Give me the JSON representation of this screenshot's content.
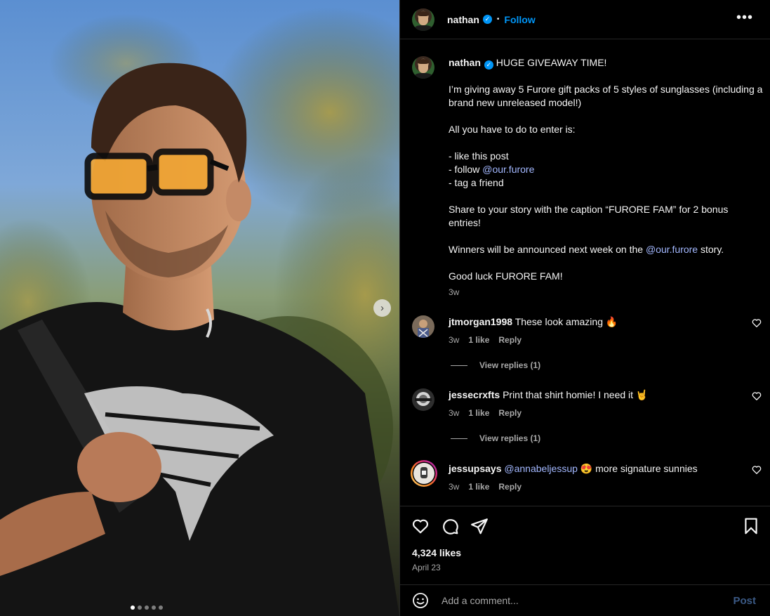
{
  "header": {
    "username": "nathan",
    "separator": "•",
    "follow_label": "Follow",
    "more_icon": "more-horizontal-icon"
  },
  "caption": {
    "username": "nathan",
    "title": "HUGE GIVEAWAY TIME!",
    "line1": "I’m giving away 5 Furore gift packs of 5 styles of sunglasses (including a brand new unreleased model!)",
    "line2": "All you have to do to enter is:",
    "step1": "- like this post",
    "step2_prefix": "- follow ",
    "step2_mention": "@our.furore",
    "step3": "- tag a friend",
    "line3": "Share to your story with the caption “FURORE FAM” for 2 bonus entries!",
    "line4_prefix": "Winners will be announced next week on the ",
    "line4_mention": "@our.furore",
    "line4_suffix": " story.",
    "line5": "Good luck FURORE FAM!",
    "time": "3w"
  },
  "comments": [
    {
      "username": "jtmorgan1998",
      "text": "These look amazing 🔥",
      "time": "3w",
      "likes": "1 like",
      "reply_label": "Reply",
      "view_replies": "View replies (1)"
    },
    {
      "username": "jessecrxfts",
      "text": "Print that shirt homie! I need it 🤘",
      "time": "3w",
      "likes": "1 like",
      "reply_label": "Reply",
      "view_replies": "View replies (1)"
    },
    {
      "username": "jessupsays",
      "mention": "@annabeljessup",
      "text": " 😍 more signature sunnies",
      "time": "3w",
      "likes": "1 like",
      "reply_label": "Reply"
    }
  ],
  "actions": {
    "likes": "4,324 likes",
    "date": "April 23"
  },
  "add_comment": {
    "placeholder": "Add a comment...",
    "post_label": "Post"
  },
  "media": {
    "next_arrow": "›",
    "slide_count": 5,
    "active_slide": 1
  },
  "colors": {
    "accent": "#0095f6",
    "mention": "#a3b8ff",
    "muted": "#a8a8a8",
    "post_disabled": "#3b5a86"
  }
}
